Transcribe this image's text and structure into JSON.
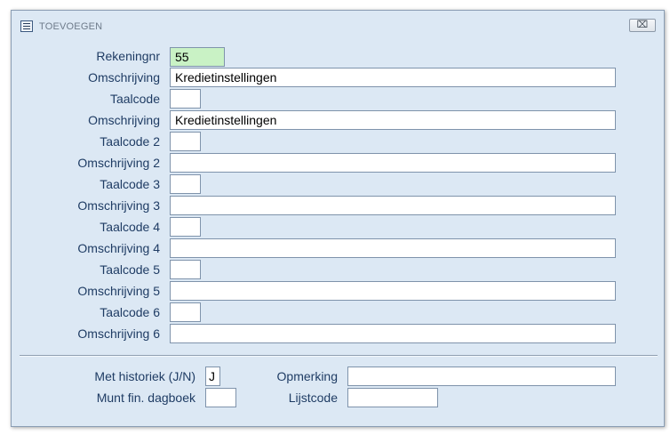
{
  "window": {
    "title": "TOEVOEGEN",
    "close_symbol": "⌧"
  },
  "icons": {
    "window_icon": "form-icon",
    "close_icon": "close-icon"
  },
  "form": {
    "rekeningnr": {
      "label": "Rekeningnr",
      "value": "55"
    },
    "omschrijving": {
      "label": "Omschrijving",
      "value": "Kredietinstellingen"
    },
    "taalcode": {
      "label": "Taalcode",
      "value": ""
    },
    "omschrijving_1": {
      "label": "Omschrijving",
      "value": "Kredietinstellingen"
    },
    "taalcode_2": {
      "label": "Taalcode 2",
      "value": ""
    },
    "omschrijving_2": {
      "label": "Omschrijving 2",
      "value": ""
    },
    "taalcode_3": {
      "label": "Taalcode 3",
      "value": ""
    },
    "omschrijving_3": {
      "label": "Omschrijving 3",
      "value": ""
    },
    "taalcode_4": {
      "label": "Taalcode 4",
      "value": ""
    },
    "omschrijving_4": {
      "label": "Omschrijving 4",
      "value": ""
    },
    "taalcode_5": {
      "label": "Taalcode 5",
      "value": ""
    },
    "omschrijving_5": {
      "label": "Omschrijving 5",
      "value": ""
    },
    "taalcode_6": {
      "label": "Taalcode 6",
      "value": ""
    },
    "omschrijving_6": {
      "label": "Omschrijving 6",
      "value": ""
    }
  },
  "footer": {
    "met_historiek": {
      "label": "Met historiek (J/N)",
      "value": "J"
    },
    "munt_fin_dagboek": {
      "label": "Munt fin. dagboek",
      "value": ""
    },
    "opmerking": {
      "label": "Opmerking",
      "value": ""
    },
    "lijstcode": {
      "label": "Lijstcode",
      "value": ""
    }
  },
  "colors": {
    "window_bg": "#dce8f4",
    "label_text": "#1f3c64",
    "highlight_field": "#c9f2c5"
  }
}
